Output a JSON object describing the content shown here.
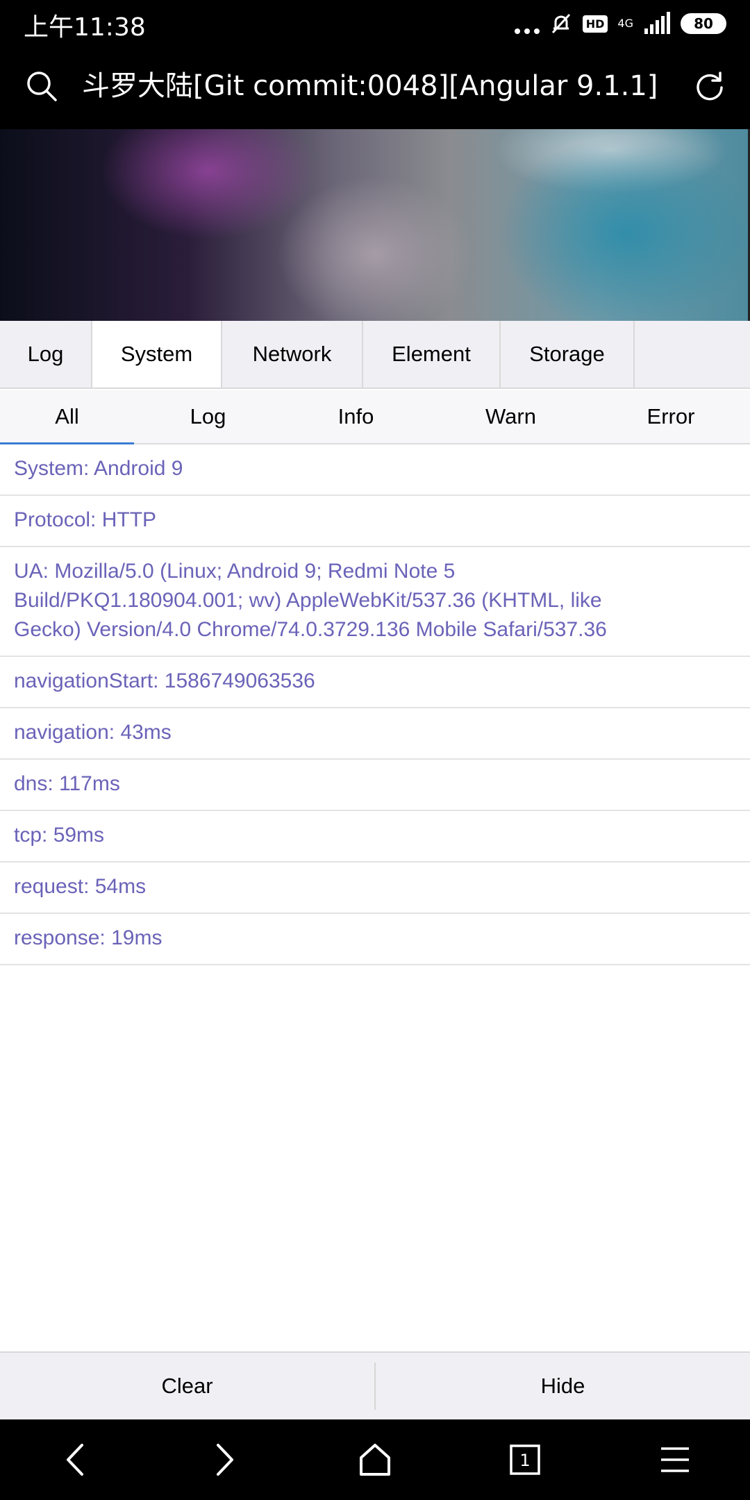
{
  "status_bar": {
    "time": "上午11:38",
    "network": "4G",
    "hd": "HD",
    "battery": "80"
  },
  "browser": {
    "title": "斗罗大陆[Git commit:0048][Angular 9.1.1]",
    "search_icon": "search-icon",
    "refresh_icon": "refresh-icon"
  },
  "main_tabs": [
    {
      "label": "Log",
      "active": false
    },
    {
      "label": "System",
      "active": true
    },
    {
      "label": "Network",
      "active": false
    },
    {
      "label": "Element",
      "active": false
    },
    {
      "label": "Storage",
      "active": false
    }
  ],
  "sub_tabs": [
    {
      "label": "All",
      "active": true
    },
    {
      "label": "Log",
      "active": false
    },
    {
      "label": "Info",
      "active": false
    },
    {
      "label": "Warn",
      "active": false
    },
    {
      "label": "Error",
      "active": false
    }
  ],
  "log_items": [
    "System: Android 9",
    "Protocol: HTTP",
    "UA: Mozilla/5.0 (Linux; Android 9; Redmi Note 5 Build/PKQ1.180904.001; wv) AppleWebKit/537.36 (KHTML, like Gecko) Version/4.0 Chrome/74.0.3729.136 Mobile Safari/537.36",
    "navigationStart: 1586749063536",
    "navigation: 43ms",
    "dns: 117ms",
    "tcp: 59ms",
    "request: 54ms",
    "response: 19ms"
  ],
  "actions": {
    "clear": "Clear",
    "hide": "Hide"
  },
  "nav": {
    "tab_count": "1"
  },
  "colors": {
    "log_text": "#6a63b8",
    "active_indicator": "#3a7bd5",
    "tab_bg": "#efeff4"
  }
}
